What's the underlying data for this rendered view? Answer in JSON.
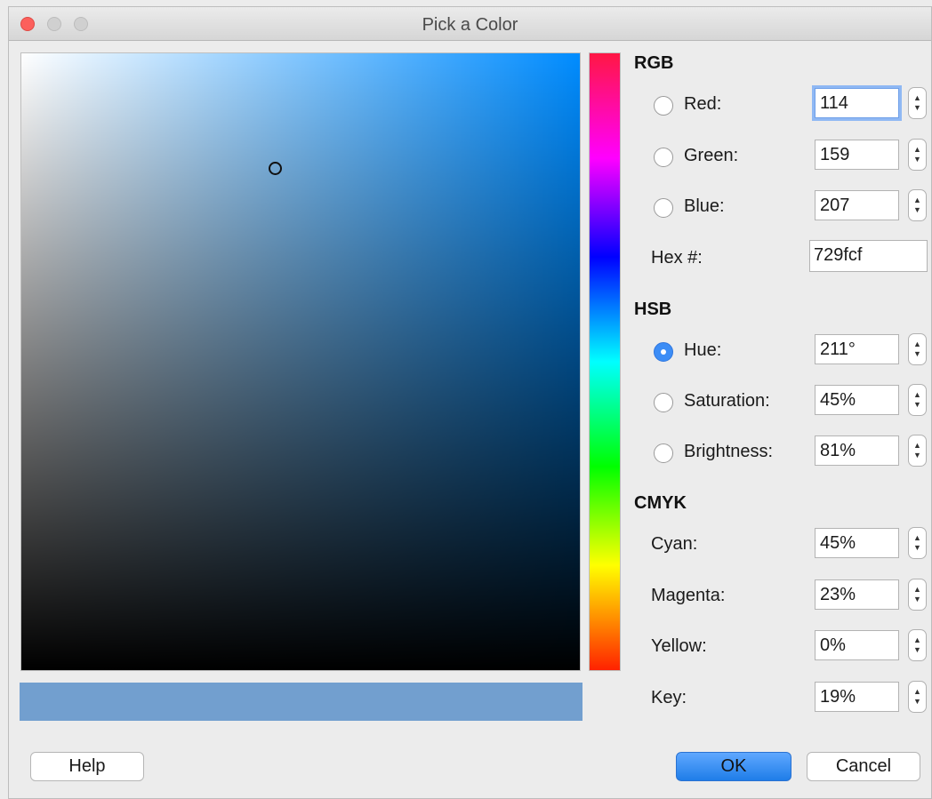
{
  "window": {
    "title": "Pick a Color"
  },
  "rgb": {
    "heading": "RGB",
    "red": {
      "label": "Red:",
      "value": "114"
    },
    "green": {
      "label": "Green:",
      "value": "159"
    },
    "blue": {
      "label": "Blue:",
      "value": "207"
    },
    "hex": {
      "label": "Hex #:",
      "value": "729fcf"
    }
  },
  "hsb": {
    "heading": "HSB",
    "hue": {
      "label": "Hue:",
      "value": "211°"
    },
    "saturation": {
      "label": "Saturation:",
      "value": "45%"
    },
    "brightness": {
      "label": "Brightness:",
      "value": "81%"
    }
  },
  "cmyk": {
    "heading": "CMYK",
    "cyan": {
      "label": "Cyan:",
      "value": "45%"
    },
    "magenta": {
      "label": "Magenta:",
      "value": "23%"
    },
    "yellow": {
      "label": "Yellow:",
      "value": "0%"
    },
    "key": {
      "label": "Key:",
      "value": "19%"
    }
  },
  "buttons": {
    "help": "Help",
    "ok": "OK",
    "cancel": "Cancel"
  },
  "colors": {
    "current": "#729fcf",
    "accent": "#3c8df6"
  }
}
